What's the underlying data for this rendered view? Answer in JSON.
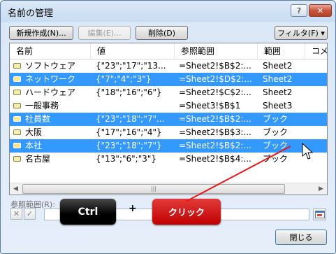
{
  "window": {
    "title": "名前の管理",
    "help": "?",
    "close": "✕"
  },
  "toolbar": {
    "new_label": "新規作成(N)...",
    "edit_label": "編集(E)...",
    "delete_label": "削除(D)",
    "filter_label": "フィルタ(F) ▾"
  },
  "columns": [
    "名前",
    "値",
    "参照範囲",
    "範囲",
    "コメ"
  ],
  "rows": [
    {
      "name": "ソフトウェア",
      "value": "{\"23\";\"17\";\"13...",
      "ref": "=Sheet2!$B$2:...",
      "scope": "Sheet2",
      "selected": false
    },
    {
      "name": "ネットワーク",
      "value": "{\"7\";\"4\";\"3\"}",
      "ref": "=Sheet2!$D$2:...",
      "scope": "Sheet2",
      "selected": true
    },
    {
      "name": "ハードウェア",
      "value": "{\"18\";\"16\";\"6\"}",
      "ref": "=Sheet2!$C$2:...",
      "scope": "Sheet2",
      "selected": false
    },
    {
      "name": "一般事務",
      "value": "",
      "ref": "=Sheet3!$B$1",
      "scope": "Sheet3",
      "selected": false
    },
    {
      "name": "社員数",
      "value": "{\"23\";\"18\";\"7\"...",
      "ref": "=Sheet2!$B$2:...",
      "scope": "ブック",
      "selected": true
    },
    {
      "name": "大阪",
      "value": "{\"17\";\"16\";\"4\"}",
      "ref": "=Sheet2!$B$3:...",
      "scope": "ブック",
      "selected": false
    },
    {
      "name": "本社",
      "value": "{\"23\";\"18\";\"7\"}",
      "ref": "=Sheet2!$B$2:...",
      "scope": "ブック",
      "selected": true
    },
    {
      "name": "名古屋",
      "value": "{\"13\";\"6\";\"3\"}",
      "ref": "=Sheet2!$B$4:...",
      "scope": "ブック",
      "selected": false
    }
  ],
  "ref_label": "参照範囲(R):",
  "close_button": "閉じる",
  "annotation": {
    "ctrl": "Ctrl",
    "plus": "+",
    "click": "クリック",
    "arrow_color": "#e81818"
  },
  "colors": {
    "selection": "#3399ff",
    "click_badge": "#c00000"
  }
}
